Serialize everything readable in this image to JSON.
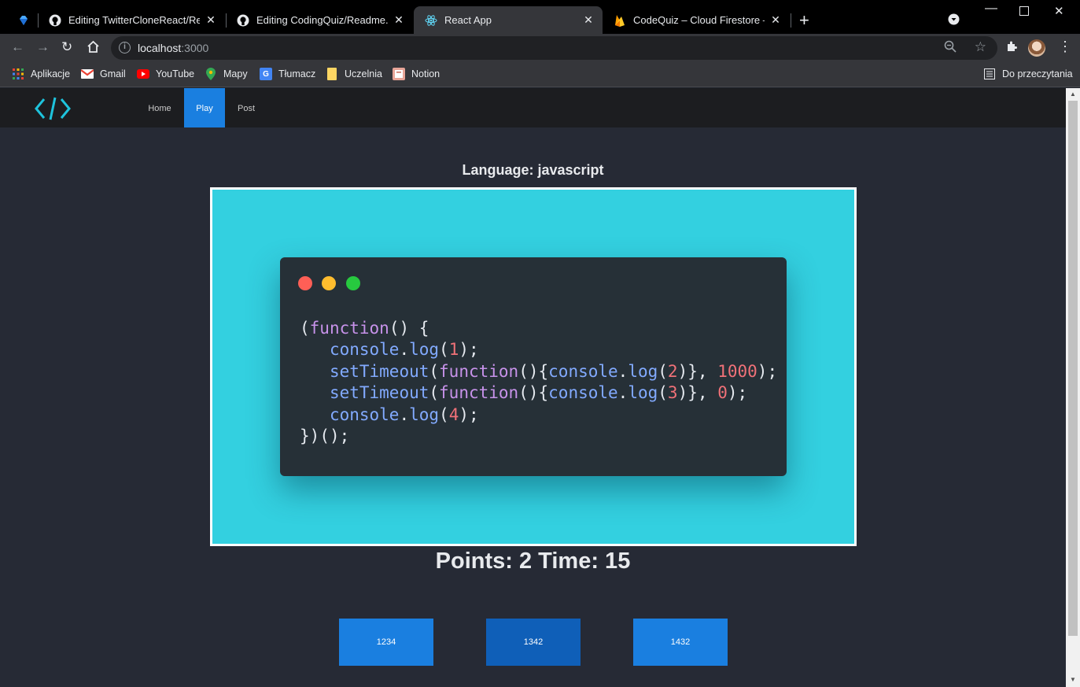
{
  "browser": {
    "tabs": [
      {
        "title": "",
        "icon": "gem-icon"
      },
      {
        "title": "Editing TwitterCloneReact/Readm",
        "icon": "github-icon"
      },
      {
        "title": "Editing CodingQuiz/Readme.md",
        "icon": "github-icon"
      },
      {
        "title": "React App",
        "icon": "react-icon",
        "active": true
      },
      {
        "title": "CodeQuiz – Cloud Firestore – Fire",
        "icon": "firebase-icon"
      }
    ],
    "url_host": "localhost",
    "url_port": ":3000",
    "bookmarks": [
      {
        "label": "Aplikacje",
        "icon": "apps-grid-icon"
      },
      {
        "label": "Gmail",
        "icon": "gmail-icon"
      },
      {
        "label": "YouTube",
        "icon": "youtube-icon"
      },
      {
        "label": "Mapy",
        "icon": "maps-icon"
      },
      {
        "label": "Tłumacz",
        "icon": "translate-icon"
      },
      {
        "label": "Uczelnia",
        "icon": "folder-icon"
      },
      {
        "label": "Notion",
        "icon": "notion-icon"
      }
    ],
    "reading_list": "Do przeczytania"
  },
  "app": {
    "nav": {
      "home": "Home",
      "play": "Play",
      "post": "Post"
    },
    "language_label": "Language: javascript",
    "code_lines": [
      "(function() {",
      "   console.log(1);",
      "   setTimeout(function(){console.log(2)}, 1000);",
      "   setTimeout(function(){console.log(3)}, 0);",
      "   console.log(4);",
      "})();"
    ],
    "score_text": "Points: 2 Time: 15",
    "answers": [
      "1234",
      "1342",
      "1432"
    ],
    "colors": {
      "accent": "#1a7fe0",
      "frame_bg": "#33d0e0",
      "code_bg": "#263037",
      "page_bg": "#262a35"
    }
  }
}
